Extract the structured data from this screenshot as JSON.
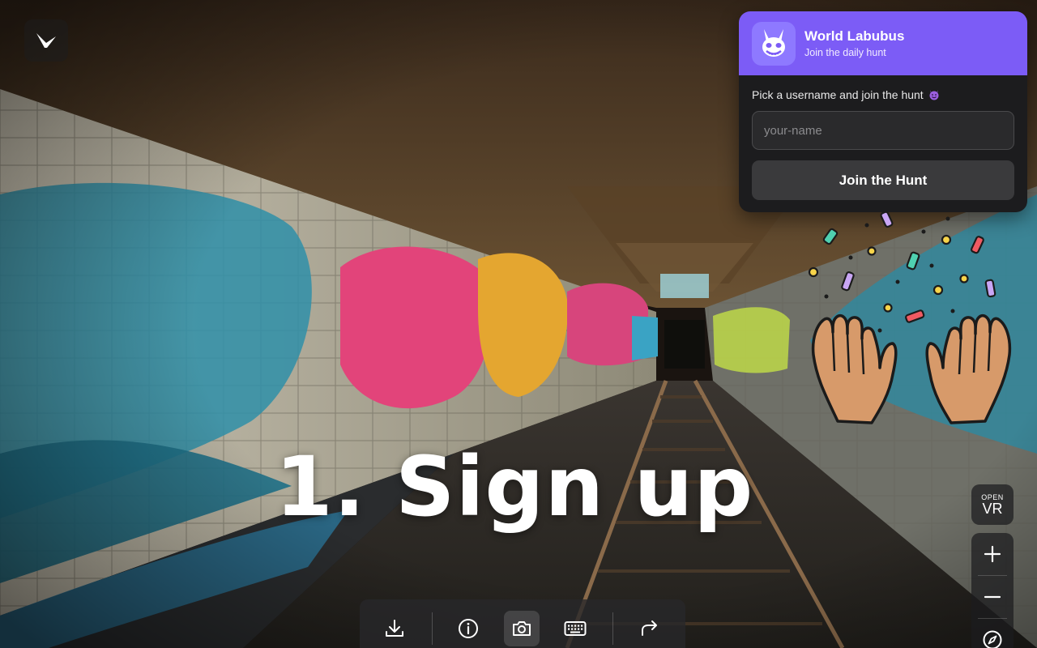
{
  "app": {
    "logo_icon": "chevron-bird-logo-icon"
  },
  "headline": "1. Sign up",
  "signup_panel": {
    "title": "World Labubus",
    "subtitle": "Join the daily hunt",
    "avatar_icon": "labubu-monster-icon",
    "prompt": "Pick a username and join the hunt",
    "prompt_emoji_icon": "smiling-devil-icon",
    "username_placeholder": "your-name",
    "username_value": "",
    "join_button_label": "Join the Hunt",
    "accent_color": "#7c5cf6"
  },
  "decoration": {
    "emoji_icon": "clapping-hands-confetti-icon"
  },
  "controls": {
    "vr_small_label": "OPEN",
    "vr_big_label": "VR",
    "zoom_in_icon": "plus-icon",
    "zoom_out_icon": "minus-icon",
    "compass_icon": "compass-icon"
  },
  "toolbar": {
    "items": [
      {
        "icon": "download-icon"
      },
      {
        "icon": "info-icon"
      },
      {
        "icon": "camera-icon",
        "active": true
      },
      {
        "icon": "keyboard-icon"
      },
      {
        "icon": "share-arrow-icon"
      }
    ]
  }
}
